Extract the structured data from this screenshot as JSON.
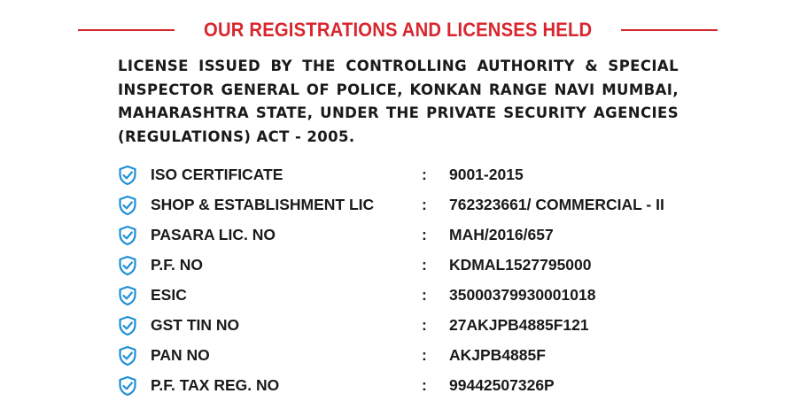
{
  "heading": {
    "title": "OUR REGISTRATIONS AND LICENSES HELD",
    "accent_color": "#d8262e"
  },
  "intro": {
    "text": "LICENSE ISSUED BY THE CONTROLLING AUTHORITY & SPECIAL INSPECTOR GENERAL OF POLICE, KONKAN RANGE NAVI MUMBAI, MAHARASHTRA STATE, UNDER THE PRIVATE SECURITY AGENCIES (REGULATIONS) ACT - 2005."
  },
  "icon": {
    "name": "shield-check-icon",
    "color": "#1f8fd6"
  },
  "rows": [
    {
      "label": "ISO CERTIFICATE",
      "sep": ":",
      "value": "9001-2015"
    },
    {
      "label": "SHOP & ESTABLISHMENT LIC",
      "sep": ":",
      "value": "762323661/ COMMERCIAL - II"
    },
    {
      "label": "PASARA LIC. NO",
      "sep": ":",
      "value": "MAH/2016/657"
    },
    {
      "label": "P.F. NO",
      "sep": ":",
      "value": "KDMAL1527795000"
    },
    {
      "label": "ESIC",
      "sep": ":",
      "value": "35000379930001018"
    },
    {
      "label": "GST TIN NO",
      "sep": ":",
      "value": "27AKJPB4885F121"
    },
    {
      "label": "PAN NO",
      "sep": ":",
      "value": "AKJPB4885F"
    },
    {
      "label": "P.F. TAX REG. NO",
      "sep": ":",
      "value": "99442507326P"
    }
  ]
}
